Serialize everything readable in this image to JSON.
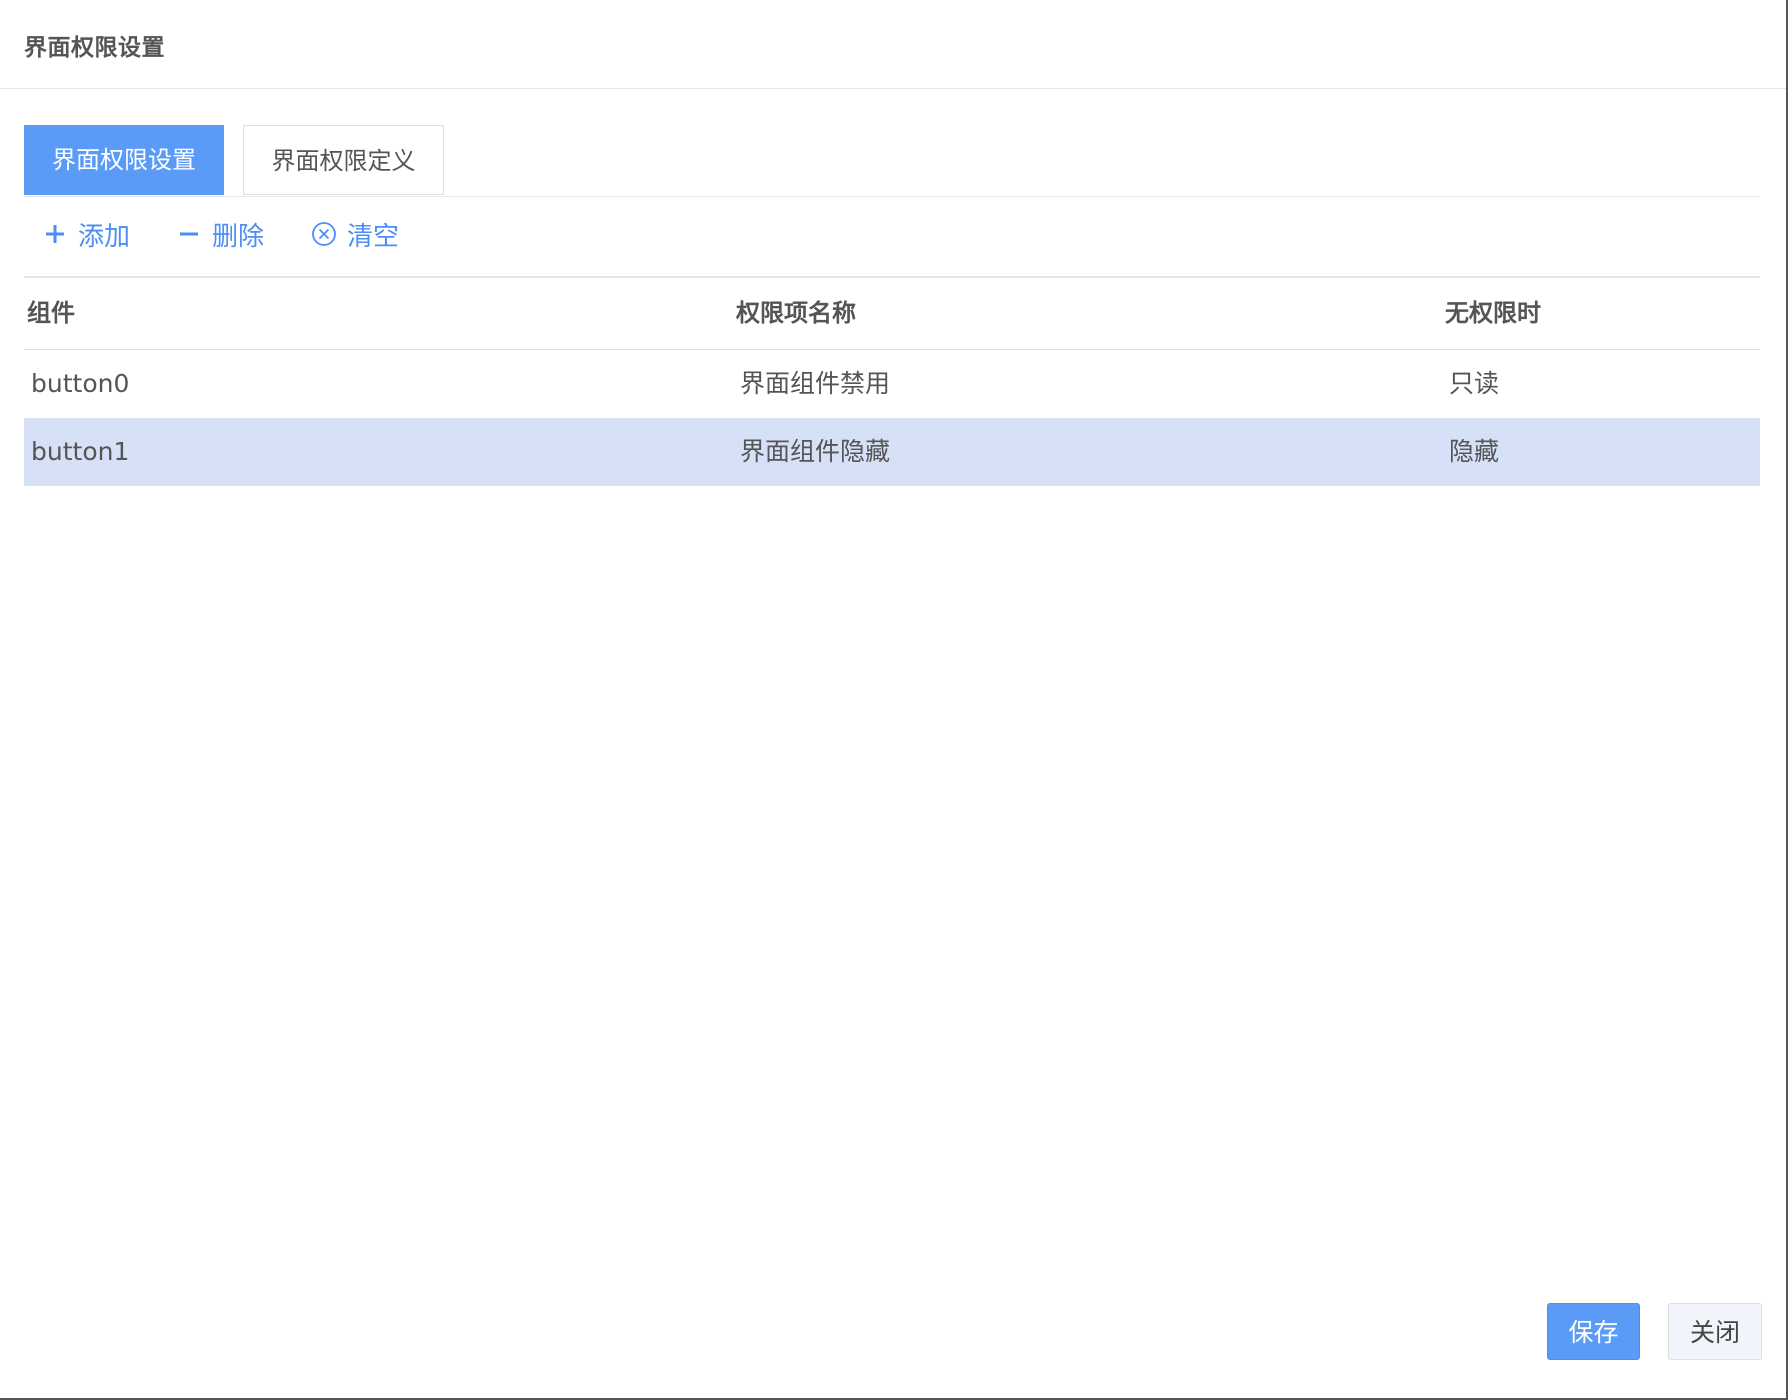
{
  "dialog": {
    "title": "界面权限设置"
  },
  "tabs": [
    {
      "label": "界面权限设置",
      "active": true
    },
    {
      "label": "界面权限定义",
      "active": false
    }
  ],
  "toolbar": {
    "add_label": "添加",
    "delete_label": "删除",
    "clear_label": "清空",
    "icons": [
      "plus-icon",
      "minus-icon",
      "circle-x-icon"
    ]
  },
  "table": {
    "columns": [
      "组件",
      "权限项名称",
      "无权限时"
    ],
    "rows": [
      {
        "component": "button0",
        "permission": "界面组件禁用",
        "no_permission": "只读",
        "selected": false
      },
      {
        "component": "button1",
        "permission": "界面组件隐藏",
        "no_permission": "隐藏",
        "selected": true
      }
    ]
  },
  "footer": {
    "save_label": "保存",
    "close_label": "关闭"
  },
  "colors": {
    "accent": "#5b9bf8",
    "link": "#4c8df6",
    "selected_row": "#d6e1f7"
  }
}
